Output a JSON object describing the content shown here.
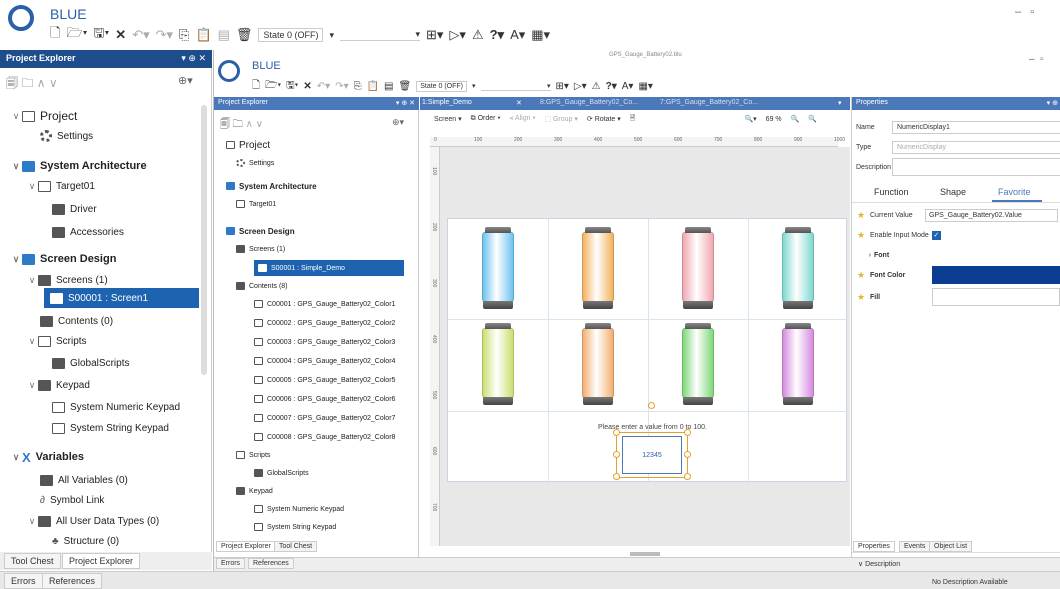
{
  "app": {
    "title": "BLUE",
    "state_select": "State 0 (OFF)",
    "inner_filename": "GPS_Gauge_Battery02.blu"
  },
  "outer_explorer": {
    "title": "Project Explorer",
    "items": [
      {
        "label": "Project",
        "level": 0
      },
      {
        "label": "Settings",
        "level": 1
      },
      {
        "label": "System Architecture",
        "level": 0
      },
      {
        "label": "Target01",
        "level": 1
      },
      {
        "label": "Driver",
        "level": 2
      },
      {
        "label": "Accessories",
        "level": 2
      },
      {
        "label": "Screen Design",
        "level": 0
      },
      {
        "label": "Screens (1)",
        "level": 1
      },
      {
        "label": "S00001 : Screen1",
        "level": 2
      },
      {
        "label": "Contents (0)",
        "level": 1
      },
      {
        "label": "Scripts",
        "level": 1
      },
      {
        "label": "GlobalScripts",
        "level": 2
      },
      {
        "label": "Keypad",
        "level": 1
      },
      {
        "label": "System Numeric Keypad",
        "level": 2
      },
      {
        "label": "System String Keypad",
        "level": 2
      },
      {
        "label": "Variables",
        "level": 0
      },
      {
        "label": "All Variables (0)",
        "level": 1
      },
      {
        "label": "Symbol Link",
        "level": 1
      },
      {
        "label": "All User Data Types (0)",
        "level": 1
      },
      {
        "label": "Structure (0)",
        "level": 2
      }
    ],
    "bottom_tabs": [
      "Tool Chest",
      "Project Explorer"
    ],
    "status_tabs": [
      "Errors",
      "References"
    ]
  },
  "inner_explorer": {
    "title": "Project Explorer",
    "items": [
      {
        "label": "Project"
      },
      {
        "label": "Settings"
      },
      {
        "label": "System Architecture"
      },
      {
        "label": "Target01"
      },
      {
        "label": "Screen Design"
      },
      {
        "label": "Screens (1)"
      },
      {
        "label": "S00001 : Simple_Demo"
      },
      {
        "label": "Contents (8)"
      },
      {
        "label": "C00001 : GPS_Gauge_Battery02_Color1"
      },
      {
        "label": "C00002 : GPS_Gauge_Battery02_Color2"
      },
      {
        "label": "C00003 : GPS_Gauge_Battery02_Color3"
      },
      {
        "label": "C00004 : GPS_Gauge_Battery02_Color4"
      },
      {
        "label": "C00005 : GPS_Gauge_Battery02_Color5"
      },
      {
        "label": "C00006 : GPS_Gauge_Battery02_Color6"
      },
      {
        "label": "C00007 : GPS_Gauge_Battery02_Color7"
      },
      {
        "label": "C00008 : GPS_Gauge_Battery02_Color8"
      },
      {
        "label": "Scripts"
      },
      {
        "label": "GlobalScripts"
      },
      {
        "label": "Keypad"
      },
      {
        "label": "System Numeric Keypad"
      },
      {
        "label": "System String Keypad"
      }
    ],
    "bottom_tabs": [
      "Project Explorer",
      "Tool Chest"
    ],
    "status_tabs": [
      "Errors",
      "References"
    ]
  },
  "doc_tabs": [
    "1:Simple_Demo",
    "8:GPS_Gauge_Battery02_Co...",
    "7:GPS_Gauge_Battery02_Co..."
  ],
  "editor_toolbar": {
    "screen": "Screen",
    "order": "Order",
    "align": "Align",
    "group": "Group",
    "rotate": "Rotate",
    "zoom": "69 %"
  },
  "ruler_ticks": [
    "0",
    "100",
    "200",
    "300",
    "400",
    "500",
    "600",
    "700",
    "800",
    "900",
    "1000"
  ],
  "vruler_ticks": [
    "100",
    "200",
    "300",
    "400",
    "500",
    "600",
    "700"
  ],
  "canvas": {
    "prompt": "Please enter a value from 0 to 100.",
    "numeric_value": "12345",
    "batteries": [
      {
        "color": "#6ec3f0"
      },
      {
        "color": "#f2b35e"
      },
      {
        "color": "#f0a8b0"
      },
      {
        "color": "#7fd8d0"
      },
      {
        "color": "#c9e070"
      },
      {
        "color": "#f2b070"
      },
      {
        "color": "#7ed87a"
      },
      {
        "color": "#d78ae0"
      }
    ]
  },
  "properties": {
    "title": "Properties",
    "name_label": "Name",
    "name_value": "NumericDisplay1",
    "type_label": "Type",
    "type_value": "NumericDisplay",
    "description_label": "Description",
    "tabs": [
      "Function",
      "Shape",
      "Favorite"
    ],
    "rows": [
      {
        "label": "Current Value",
        "value": "GPS_Gauge_Battery02.Value"
      },
      {
        "label": "Enable Input Mode",
        "value": ""
      },
      {
        "label": "Font",
        "value": ""
      },
      {
        "label": "Font Color",
        "value": ""
      },
      {
        "label": "Fill",
        "value": ""
      }
    ],
    "font_color": "#0a3d91",
    "desc_section": "Description",
    "desc_text": "No Description Available",
    "bottom_tabs": [
      "Properties",
      "Events",
      "Object List"
    ]
  },
  "colors": {
    "accent": "#1e4d8c",
    "selected": "#1e63b0"
  }
}
